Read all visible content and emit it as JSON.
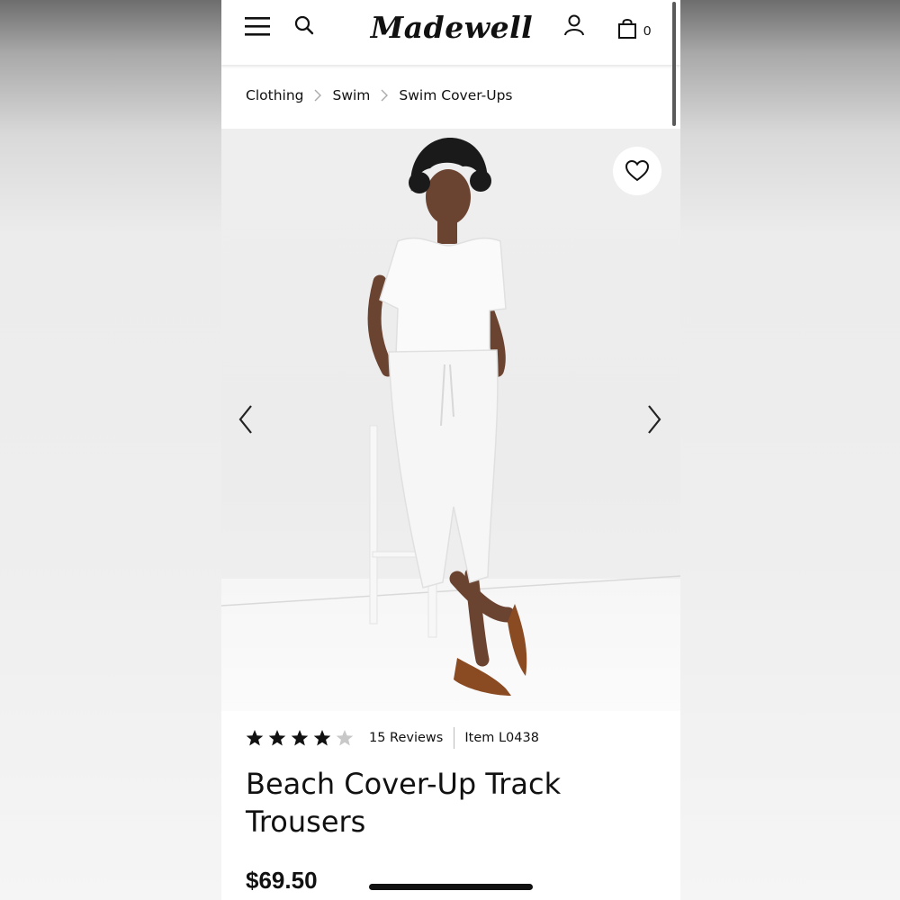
{
  "header": {
    "logo_text": "Madewell",
    "bag_count": "0",
    "icons": [
      "hamburger-menu-icon",
      "search-icon",
      "account-icon",
      "shopping-bag-icon"
    ]
  },
  "breadcrumb": [
    "Clothing",
    "Swim",
    "Swim Cover-Ups"
  ],
  "hero": {
    "icons": [
      "heart-icon",
      "chevron-left-icon",
      "chevron-right-icon"
    ]
  },
  "product": {
    "rating": 4,
    "rating_max": 5,
    "reviews_label": "15 Reviews",
    "item_label": "Item L0438",
    "title": "Beach Cover-Up Track Trousers",
    "price": "$69.50"
  },
  "colors": {
    "background": "#ffffff",
    "text": "#111111",
    "star_filled": "#111111",
    "star_empty": "#c8c8c8"
  }
}
